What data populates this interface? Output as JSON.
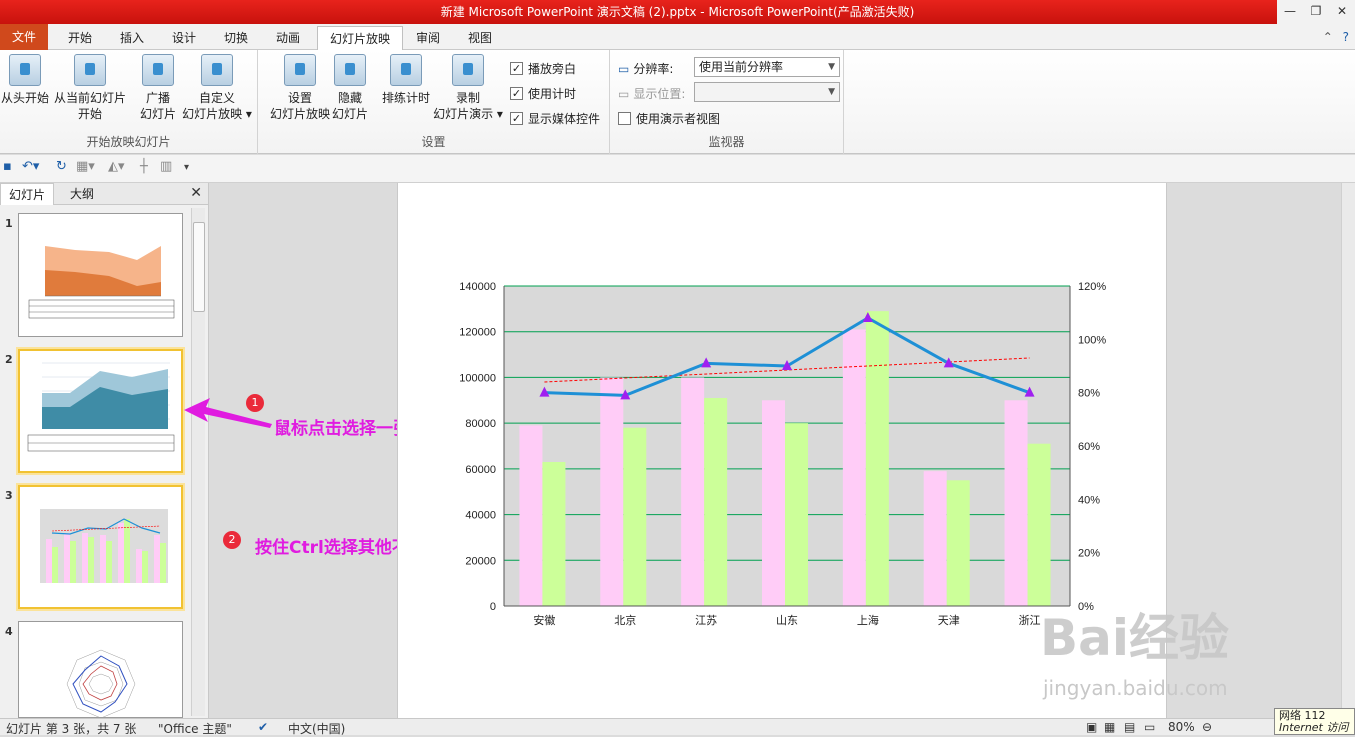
{
  "window": {
    "title": "新建 Microsoft PowerPoint 演示文稿 (2).pptx - Microsoft PowerPoint(产品激活失败)"
  },
  "tabs": [
    "文件",
    "开始",
    "插入",
    "设计",
    "切换",
    "动画",
    "幻灯片放映",
    "审阅",
    "视图"
  ],
  "active_tab": "幻灯片放映",
  "ribbon": {
    "group_start": {
      "label": "开始放映幻灯片",
      "buttons": [
        {
          "l1": "从头开始",
          "l2": ""
        },
        {
          "l1": "从当前幻灯片",
          "l2": "开始"
        },
        {
          "l1": "广播",
          "l2": "幻灯片"
        },
        {
          "l1": "自定义",
          "l2": "幻灯片放映 ▾"
        }
      ]
    },
    "group_setup": {
      "label": "设置",
      "buttons": [
        {
          "l1": "设置",
          "l2": "幻灯片放映"
        },
        {
          "l1": "隐藏",
          "l2": "幻灯片"
        },
        {
          "l1": "排练计时",
          "l2": ""
        },
        {
          "l1": "录制",
          "l2": "幻灯片演示 ▾"
        }
      ],
      "checks": [
        {
          "label": "播放旁白",
          "checked": true
        },
        {
          "label": "使用计时",
          "checked": true
        },
        {
          "label": "显示媒体控件",
          "checked": true
        }
      ]
    },
    "group_monitor": {
      "label": "监视器",
      "resolution_label": "分辨率:",
      "resolution_value": "使用当前分辨率",
      "display_label": "显示位置:",
      "display_value": "",
      "presenter_label": "使用演示者视图"
    }
  },
  "panel": {
    "tabs": [
      "幻灯片",
      "大纲"
    ],
    "slide_numbers": [
      "1",
      "2",
      "3",
      "4"
    ]
  },
  "annotations": [
    {
      "num": "1",
      "text": "鼠标点击选择一张幻灯片"
    },
    {
      "num": "2",
      "text": "按住Ctrl选择其他不想播放的幻灯片"
    }
  ],
  "status": {
    "slide": "幻灯片 第 3 张，共 7 张",
    "theme": "\"Office 主题\"",
    "lang": "中文(中国)",
    "zoom": "80%"
  },
  "tooltip": {
    "line1": "网络 112",
    "line2": "Internet 访问"
  },
  "watermark": {
    "logo": "Bai经验",
    "url": "jingyan.baidu.com"
  },
  "chart_data": {
    "type": "bar",
    "categories": [
      "安徽",
      "北京",
      "江苏",
      "山东",
      "上海",
      "天津",
      "浙江"
    ],
    "series": [
      {
        "values": [
          79000,
          100000,
          100000,
          90000,
          121000,
          59000,
          90000
        ],
        "color": "#ffccf7"
      },
      {
        "values": [
          63000,
          78000,
          91000,
          80000,
          129000,
          55000,
          71000
        ],
        "color": "#ccff99"
      }
    ],
    "line": {
      "values": [
        0.8,
        0.79,
        0.91,
        0.9,
        1.08,
        0.91,
        0.8
      ],
      "color": "#1e90d6",
      "marker_color": "#a020f0",
      "axis": "y2"
    },
    "trendline": {
      "start": 0.84,
      "end": 0.93,
      "color": "#ff0000"
    },
    "ylim": [
      0,
      140000
    ],
    "yticks": [
      "0",
      "20000",
      "40000",
      "60000",
      "80000",
      "100000",
      "120000",
      "140000"
    ],
    "y2lim": [
      0,
      1.2
    ],
    "y2ticks": [
      "0%",
      "20%",
      "40%",
      "60%",
      "80%",
      "100%",
      "120%"
    ],
    "plot_bg": "#d9d9d9",
    "grid_color": "#00a050"
  }
}
